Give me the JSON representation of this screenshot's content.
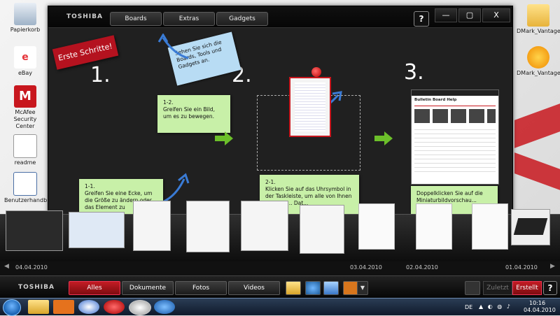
{
  "desktop": {
    "icons_left": [
      {
        "label": "Papierkorb"
      },
      {
        "label": "eBay"
      },
      {
        "label": "McAfee Security Center"
      },
      {
        "label": "readme"
      },
      {
        "label": "Benutzerhandb"
      }
    ],
    "icons_right": [
      {
        "label": "DMark_Vantage_v1..."
      },
      {
        "label": "DMark_Vantage_v1..."
      }
    ]
  },
  "window": {
    "brand": "TOSHIBA",
    "tabs": [
      {
        "label": "Boards"
      },
      {
        "label": "Extras"
      },
      {
        "label": "Gadgets"
      }
    ],
    "help_label": "?",
    "minimize_label": "—",
    "maximize_label": "▢",
    "close_label": "X"
  },
  "board": {
    "ribbon_text": "Erste Schritte!",
    "steps": [
      "1.",
      "2.",
      "3."
    ],
    "notes": {
      "tour_hint": "Sehen Sie sich die Boards, Tools und Gadgets an.",
      "step_1_2": "1-2.\nGreifen Sie ein Bild, um es zu bewegen.",
      "step_1_1": "1-1.\nGreifen Sie eine Ecke, um die Größe zu ändern oder das Element zu",
      "step_2_1": "2-1.\nKlicken Sie auf das Uhrsymbol in der Taskleiste, um alle von Ihnen kürzlich ... Dat...",
      "step_3": "Doppelklicken Sie auf die Miniaturbildvorschau... rufen."
    },
    "help_doc_title": "Bulletin Board Help"
  },
  "filmstrip": {
    "dates": [
      "04.04.2010",
      "03.04.2010",
      "02.04.2010",
      "01.04.2010"
    ]
  },
  "toolbar": {
    "brand": "TOSHIBA",
    "filters": [
      {
        "label": "Alles",
        "active": true
      },
      {
        "label": "Dokumente",
        "active": false
      },
      {
        "label": "Fotos",
        "active": false
      },
      {
        "label": "Videos",
        "active": false
      }
    ],
    "sort_recent": "Zuletzt",
    "sort_created": "Erstellt",
    "help_label": "?"
  },
  "taskbar": {
    "language": "DE",
    "time": "10:16",
    "date": "04.04.2010"
  },
  "colors": {
    "accent_red": "#c8171e",
    "note_green": "#c8f0a8",
    "note_blue": "#b8dcf4"
  }
}
